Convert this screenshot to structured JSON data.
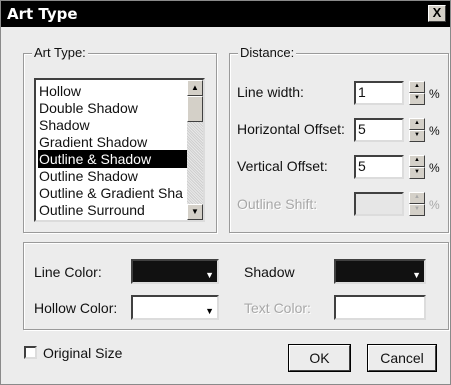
{
  "window": {
    "title": "Art Type",
    "close_glyph": "X"
  },
  "art_type": {
    "group_label": "Art Type:",
    "items": [
      "Hollow",
      "Double Shadow",
      "Shadow",
      "Gradient Shadow",
      "Outline & Shadow",
      "Outline Shadow",
      "Outline & Gradient Sha",
      "Outline Surround"
    ],
    "selected": "Outline & Shadow",
    "scroll_up_glyph": "▲",
    "scroll_down_glyph": "▼"
  },
  "distance": {
    "group_label": "Distance:",
    "line_width": {
      "label": "Line width:",
      "value": "1",
      "unit": "%"
    },
    "horizontal_offset": {
      "label": "Horizontal Offset:",
      "value": "5",
      "unit": "%"
    },
    "vertical_offset": {
      "label": "Vertical Offset:",
      "value": "5",
      "unit": "%"
    },
    "outline_shift": {
      "label": "Outline Shift:",
      "value": "",
      "unit": "%",
      "enabled": false
    }
  },
  "colors": {
    "line_color": {
      "label": "Line Color:",
      "swatch": "#111111"
    },
    "shadow": {
      "label": "Shadow",
      "swatch": "#111111"
    },
    "hollow_color": {
      "label": "Hollow Color:",
      "swatch": "#ffffff"
    },
    "text_color": {
      "label": "Text Color:",
      "swatch": "#ffffff",
      "enabled": false
    },
    "dropdown_glyph": "▼"
  },
  "options": {
    "original_size_label": "Original Size",
    "original_size_checked": false
  },
  "buttons": {
    "ok": "OK",
    "cancel": "Cancel"
  }
}
